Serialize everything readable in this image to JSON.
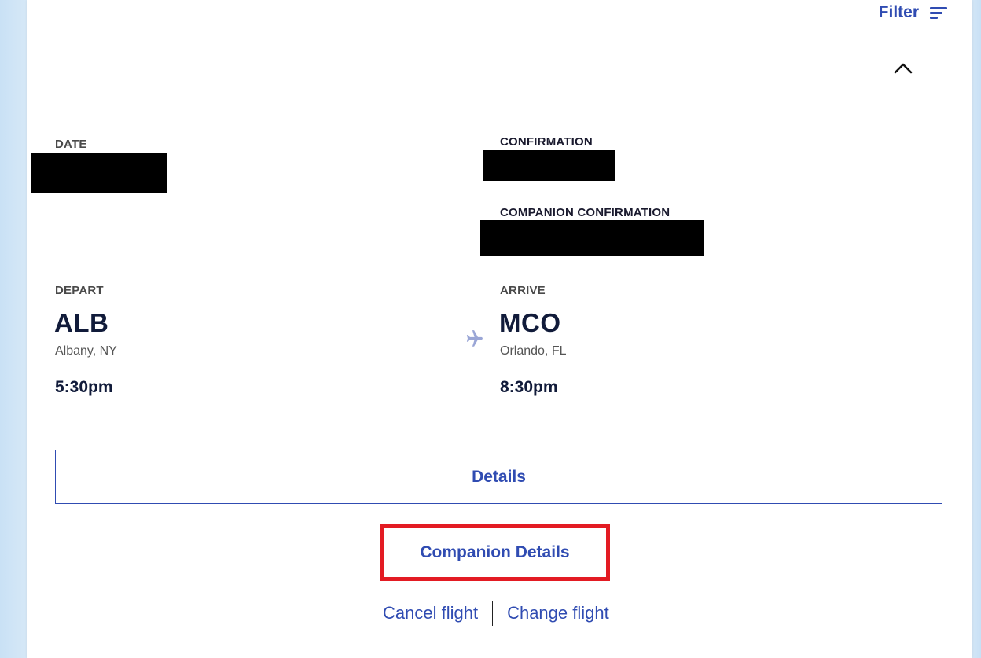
{
  "filter": {
    "label": "Filter",
    "icon": "filter-lines-icon"
  },
  "collapse": {
    "icon": "chevron-up-icon"
  },
  "booking": {
    "date_label": "DATE",
    "confirmation_label": "CONFIRMATION",
    "companion_confirmation_label": "COMPANION CONFIRMATION"
  },
  "depart": {
    "label": "DEPART",
    "code": "ALB",
    "city": "Albany, NY",
    "time": "5:30pm"
  },
  "arrive": {
    "label": "ARRIVE",
    "code": "MCO",
    "city": "Orlando, FL",
    "time": "8:30pm"
  },
  "buttons": {
    "details": "Details",
    "companion_details": "Companion Details",
    "cancel_flight": "Cancel flight",
    "change_flight": "Change flight"
  },
  "colors": {
    "accent": "#304cb2",
    "highlight": "#e31b23",
    "plane_icon": "#9aa6d6"
  }
}
